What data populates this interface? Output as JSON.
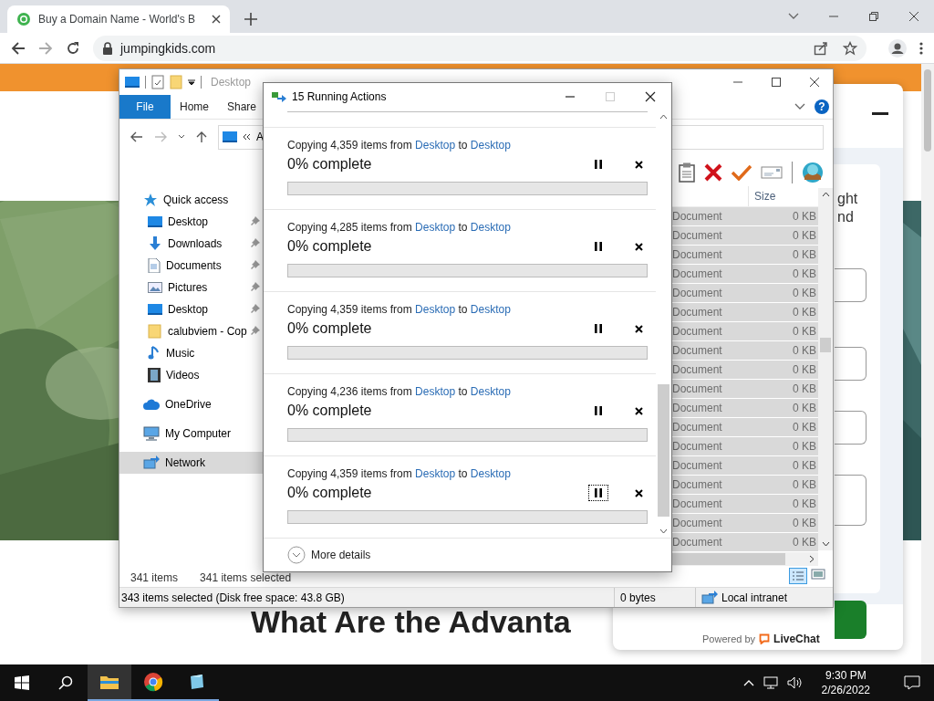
{
  "browser": {
    "tab_title": "Buy a Domain Name - World's B",
    "url": "jumpingkids.com"
  },
  "page": {
    "heading": "What Are the Advanta",
    "side_text": [
      "ght",
      "nd"
    ],
    "chat": {
      "powered_by": "Powered by",
      "brand": "LiveChat"
    }
  },
  "explorer": {
    "title": "Desktop",
    "ribbon_tabs": [
      {
        "label": "File",
        "selected": true
      },
      {
        "label": "Home",
        "selected": false
      },
      {
        "label": "Share",
        "selected": false
      }
    ],
    "help": "?",
    "address": "A",
    "nav": [
      {
        "label": "Quick access",
        "kind": "star",
        "selected": false,
        "children": [
          {
            "label": "Desktop",
            "kind": "desktop",
            "pinned": true,
            "selected": false
          },
          {
            "label": "Downloads",
            "kind": "download",
            "pinned": true,
            "selected": false
          },
          {
            "label": "Documents",
            "kind": "document",
            "pinned": true,
            "selected": false
          },
          {
            "label": "Pictures",
            "kind": "pictures",
            "pinned": true,
            "selected": false
          },
          {
            "label": "Desktop",
            "kind": "desktop",
            "pinned": true,
            "selected": false
          },
          {
            "label": "calubviem - Cop",
            "kind": "folder",
            "pinned": true,
            "selected": false
          },
          {
            "label": "Music",
            "kind": "music",
            "pinned": false,
            "selected": false
          },
          {
            "label": "Videos",
            "kind": "video",
            "pinned": false,
            "selected": false
          }
        ]
      },
      {
        "label": "OneDrive",
        "kind": "cloud",
        "selected": false
      },
      {
        "label": "My Computer",
        "kind": "computer",
        "selected": false
      },
      {
        "label": "Network",
        "kind": "network",
        "selected": true
      }
    ],
    "column": "Size",
    "rows": [
      {
        "type": "Document",
        "size": "0 KB",
        "selected": true
      },
      {
        "type": "Document",
        "size": "0 KB",
        "selected": true
      },
      {
        "type": "Document",
        "size": "0 KB",
        "selected": true
      },
      {
        "type": "Document",
        "size": "0 KB",
        "selected": true
      },
      {
        "type": "Document",
        "size": "0 KB",
        "selected": true
      },
      {
        "type": "Document",
        "size": "0 KB",
        "selected": true
      },
      {
        "type": "Document",
        "size": "0 KB",
        "selected": true
      },
      {
        "type": "Document",
        "size": "0 KB",
        "selected": true
      },
      {
        "type": "Document",
        "size": "0 KB",
        "selected": true
      },
      {
        "type": "Document",
        "size": "0 KB",
        "selected": true
      },
      {
        "type": "Document",
        "size": "0 KB",
        "selected": true
      },
      {
        "type": "Document",
        "size": "0 KB",
        "selected": true
      },
      {
        "type": "Document",
        "size": "0 KB",
        "selected": true
      },
      {
        "type": "Document",
        "size": "0 KB",
        "selected": true
      },
      {
        "type": "Document",
        "size": "0 KB",
        "selected": true
      },
      {
        "type": "Document",
        "size": "0 KB",
        "selected": true
      },
      {
        "type": "Document",
        "size": "0 KB",
        "selected": true
      },
      {
        "type": "Document",
        "size": "0 KB",
        "selected": true
      }
    ],
    "item_count": "341 items",
    "selected_count": "341 items selected",
    "status": "343 items selected (Disk free space: 43.8 GB)",
    "bytes": "0 bytes",
    "zone": "Local intranet"
  },
  "dialog": {
    "title": "15 Running Actions",
    "actions": [
      {
        "prefix": "Copying 4,359 items from",
        "source": "Desktop",
        "joiner": "to",
        "dest": "Desktop",
        "progress": "0% complete",
        "level": 0,
        "focused": false
      },
      {
        "prefix": "Copying 4,285 items from",
        "source": "Desktop",
        "joiner": "to",
        "dest": "Desktop",
        "progress": "0% complete",
        "level": 0,
        "focused": false
      },
      {
        "prefix": "Copying 4,359 items from",
        "source": "Desktop",
        "joiner": "to",
        "dest": "Desktop",
        "progress": "0% complete",
        "level": 0,
        "focused": false
      },
      {
        "prefix": "Copying 4,236 items from",
        "source": "Desktop",
        "joiner": "to",
        "dest": "Desktop",
        "progress": "0% complete",
        "level": 0,
        "focused": false
      },
      {
        "prefix": "Copying 4,359 items from",
        "source": "Desktop",
        "joiner": "to",
        "dest": "Desktop",
        "progress": "0% complete",
        "level": 0,
        "focused": true
      }
    ],
    "more": "More details"
  },
  "taskbar": {
    "time": "9:30 PM",
    "date": "2/26/2022"
  }
}
